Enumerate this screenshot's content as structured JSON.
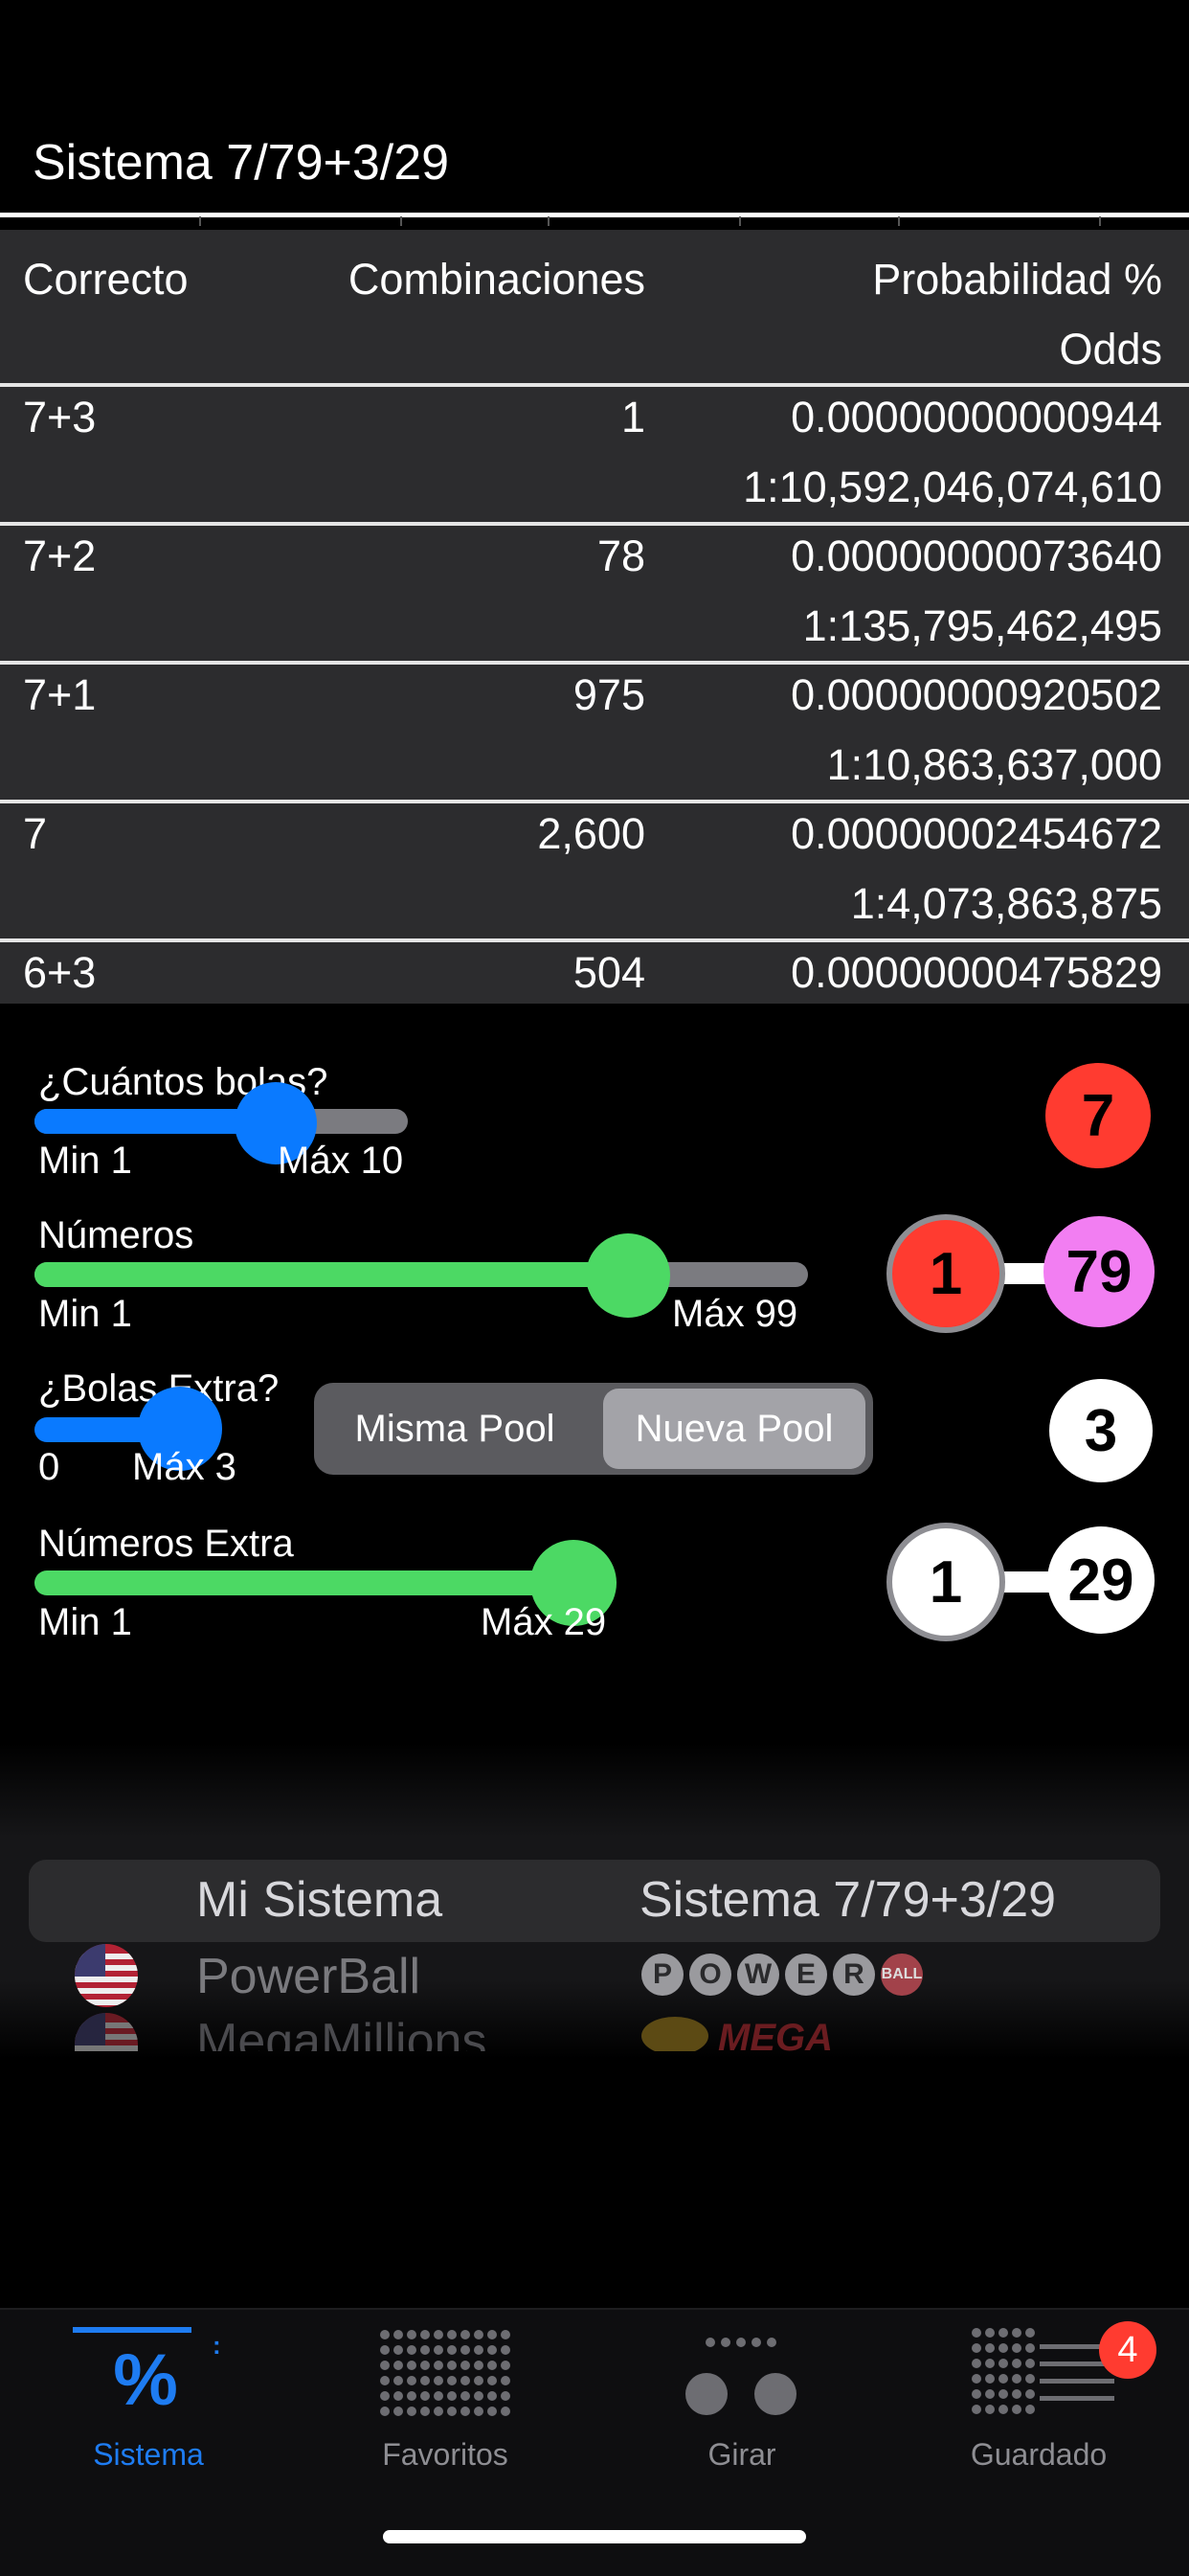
{
  "header": {
    "title": "Sistema 7/79+3/29"
  },
  "table": {
    "headers": {
      "correct": "Correcto",
      "combinations": "Combinaciones",
      "probability": "Probabilidad %",
      "odds": "Odds"
    },
    "rows": [
      {
        "correct": "7+3",
        "combinations": "1",
        "probability": "0.00000000000944",
        "odds": "1:10,592,046,074,610"
      },
      {
        "correct": "7+2",
        "combinations": "78",
        "probability": "0.00000000073640",
        "odds": "1:135,795,462,495"
      },
      {
        "correct": "7+1",
        "combinations": "975",
        "probability": "0.00000000920502",
        "odds": "1:10,863,637,000"
      },
      {
        "correct": "7",
        "combinations": "2,600",
        "probability": "0.00000002454672",
        "odds": "1:4,073,863,875"
      },
      {
        "correct": "6+3",
        "combinations": "504",
        "probability": "0.00000000475829",
        "odds": ""
      }
    ]
  },
  "controls": {
    "balls": {
      "label": "¿Cuántos bolas?",
      "min": "Min 1",
      "max": "Máx 10",
      "value": "7",
      "fraction": 0.667,
      "color": "#ff3b30"
    },
    "numbers": {
      "label": "Números",
      "min": "Min 1",
      "max": "Máx 99",
      "from": "1",
      "to": "79",
      "fraction": 0.79,
      "from_color": "#ff3b30",
      "to_color": "#f27ef2"
    },
    "extra_balls": {
      "label": "¿Bolas Extra?",
      "min": "0",
      "max": "Máx 3",
      "value": "3",
      "fraction": 1.0
    },
    "extra_numbers": {
      "label": "Números Extra",
      "min": "Min 1",
      "max": "Máx 29",
      "from": "1",
      "to": "29",
      "fraction": 1.0
    },
    "pool_segment": {
      "options": [
        "Misma Pool",
        "Nueva Pool"
      ],
      "selected": "Nueva Pool"
    }
  },
  "picker": {
    "rows": [
      {
        "left": "Mi Sistema",
        "right": "Sistema 7/79+3/29",
        "selected": true
      },
      {
        "left": "PowerBall",
        "right": "POWERBALL"
      },
      {
        "left": "MegaMillions",
        "right": "MEGA"
      }
    ]
  },
  "tabbar": {
    "tabs": [
      {
        "label": "Sistema",
        "icon": "percent-icon",
        "active": true
      },
      {
        "label": "Favoritos",
        "icon": "grid-dots-icon"
      },
      {
        "label": "Girar",
        "icon": "spin-balls-icon"
      },
      {
        "label": "Guardado",
        "icon": "saved-list-icon",
        "badge": "4"
      }
    ],
    "accent": "#1e7cf2"
  },
  "colors": {
    "blue": "#0a7aff",
    "green": "#4cd964",
    "red": "#ff3b30",
    "pink": "#f27ef2"
  }
}
